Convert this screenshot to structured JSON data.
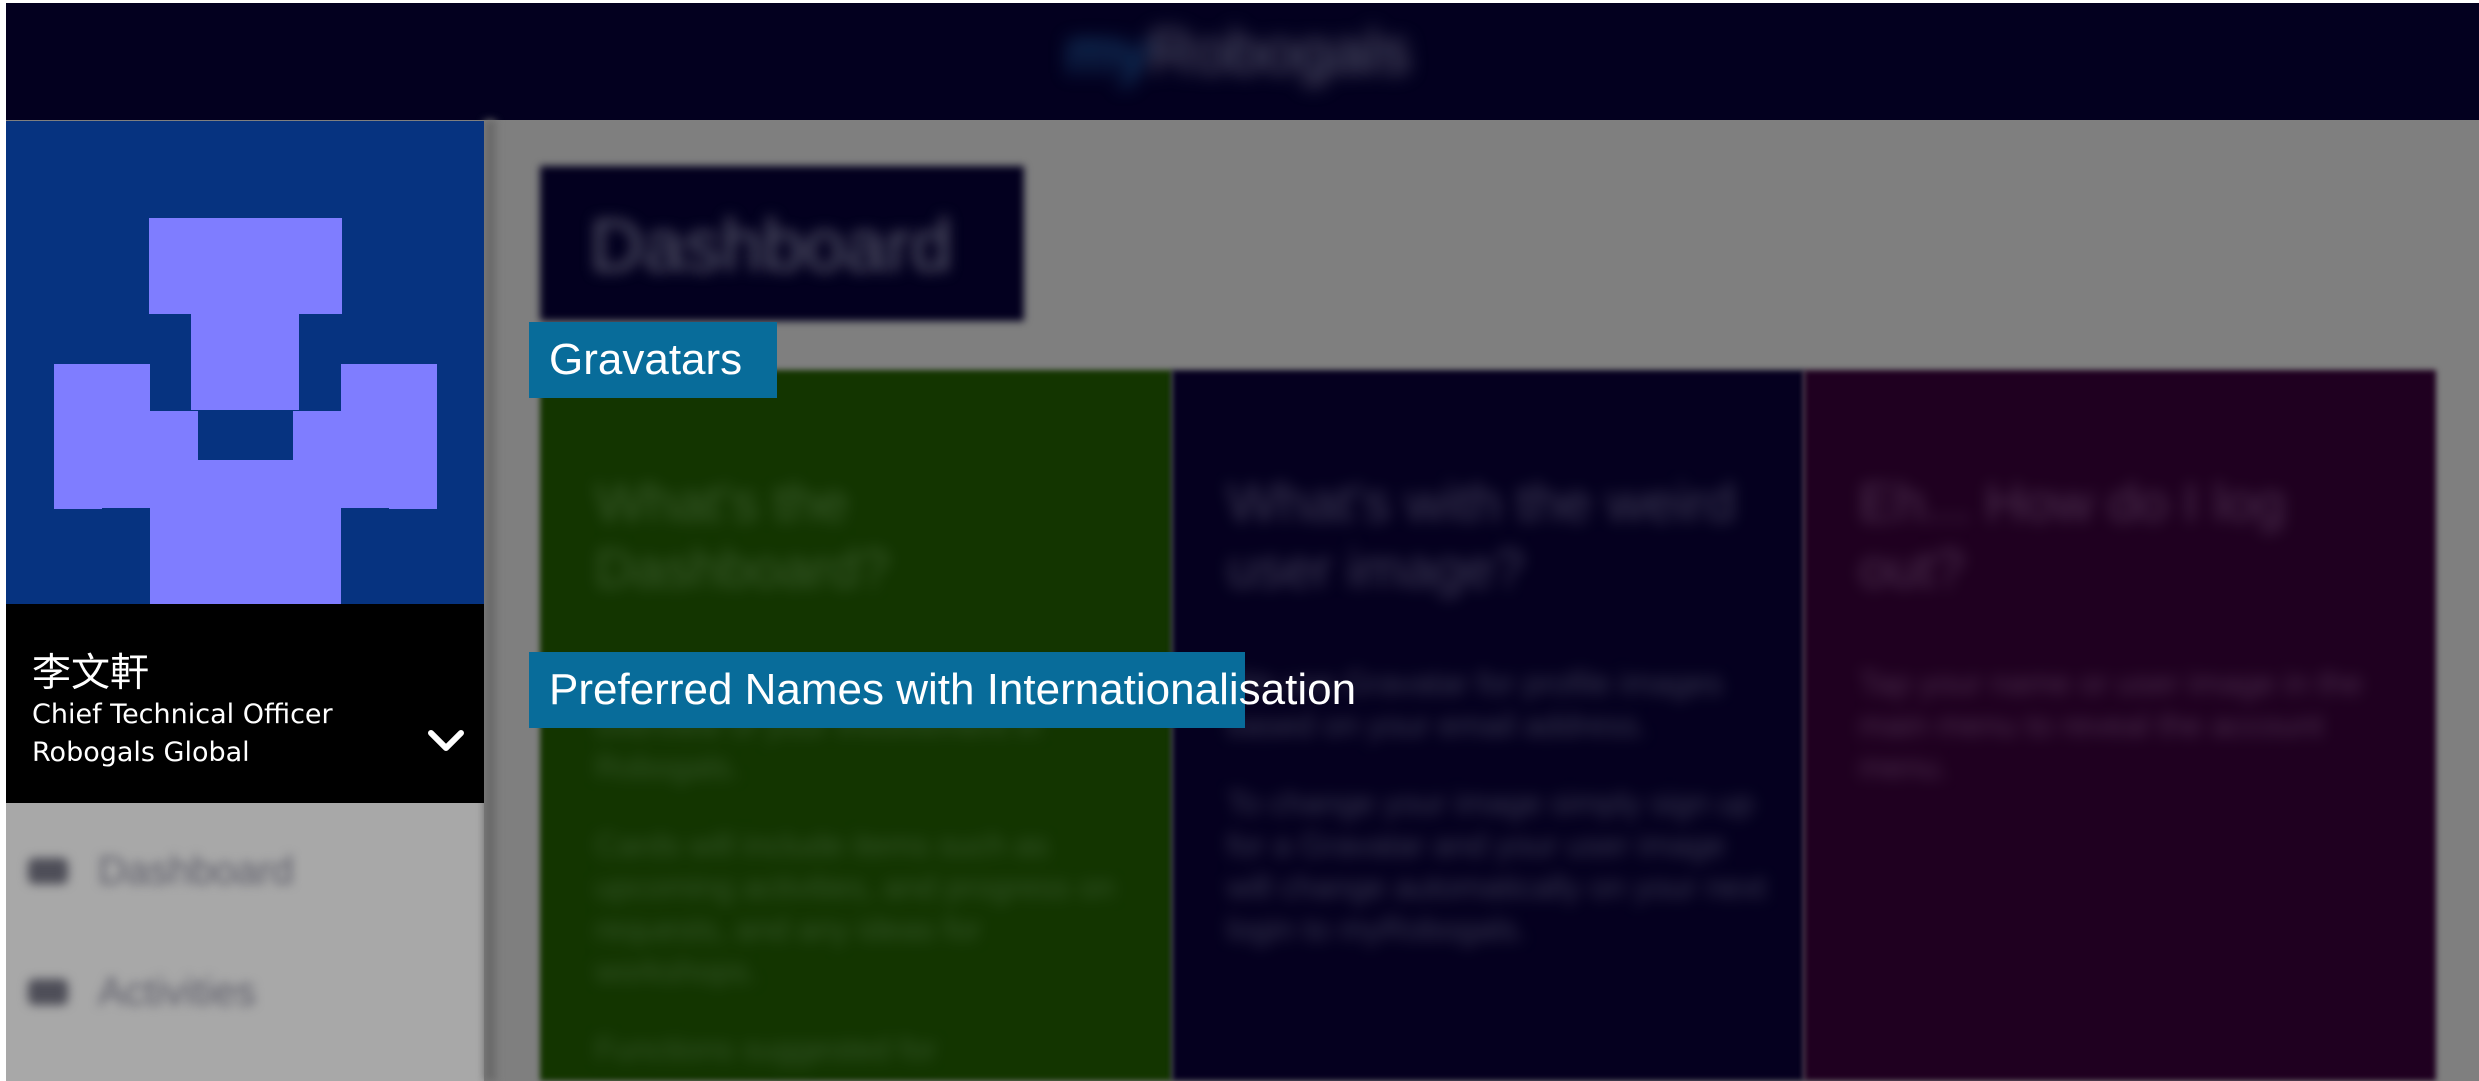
{
  "header": {
    "brand_prefix": "my",
    "brand_name": "Robogals"
  },
  "profile": {
    "name": "李文軒",
    "title": "Chief Technical Officer",
    "organisation": "Robogals Global",
    "avatar_colors": {
      "background": "#063380",
      "pattern": "#7f7dff"
    }
  },
  "sidebar": {
    "items": [
      {
        "label": "Dashboard",
        "icon": "dashboard-icon"
      },
      {
        "label": "Activities",
        "icon": "activities-icon"
      }
    ]
  },
  "main": {
    "page_title": "Dashboard",
    "cards": [
      {
        "heading": "What's the Dashboard?",
        "paragraphs": [
          "The dashboard is where you'll find an overview of your involvement in Robogals.",
          "Cards will include items such as upcoming activities, and progress on requests, and any ideas for workshops.",
          "Functions suggested for"
        ],
        "color": "#133500"
      },
      {
        "heading": "What's with the weird user image?",
        "paragraphs": [
          "We use Gravatar for profile images based on your email address.",
          "To change your image simply sign up for a Gravatar and your user image will change automatically on your next login to myRobogals."
        ],
        "color": "#05001f"
      },
      {
        "heading": "Eh... How do I log out?",
        "paragraphs": [
          "Tap your name or user image in the main menu to reveal the account menu."
        ],
        "color": "#1f0020"
      }
    ]
  },
  "tooltips": {
    "gravatars": "Gravatars",
    "preferred_names": "Preferred Names with Internationalisation"
  }
}
